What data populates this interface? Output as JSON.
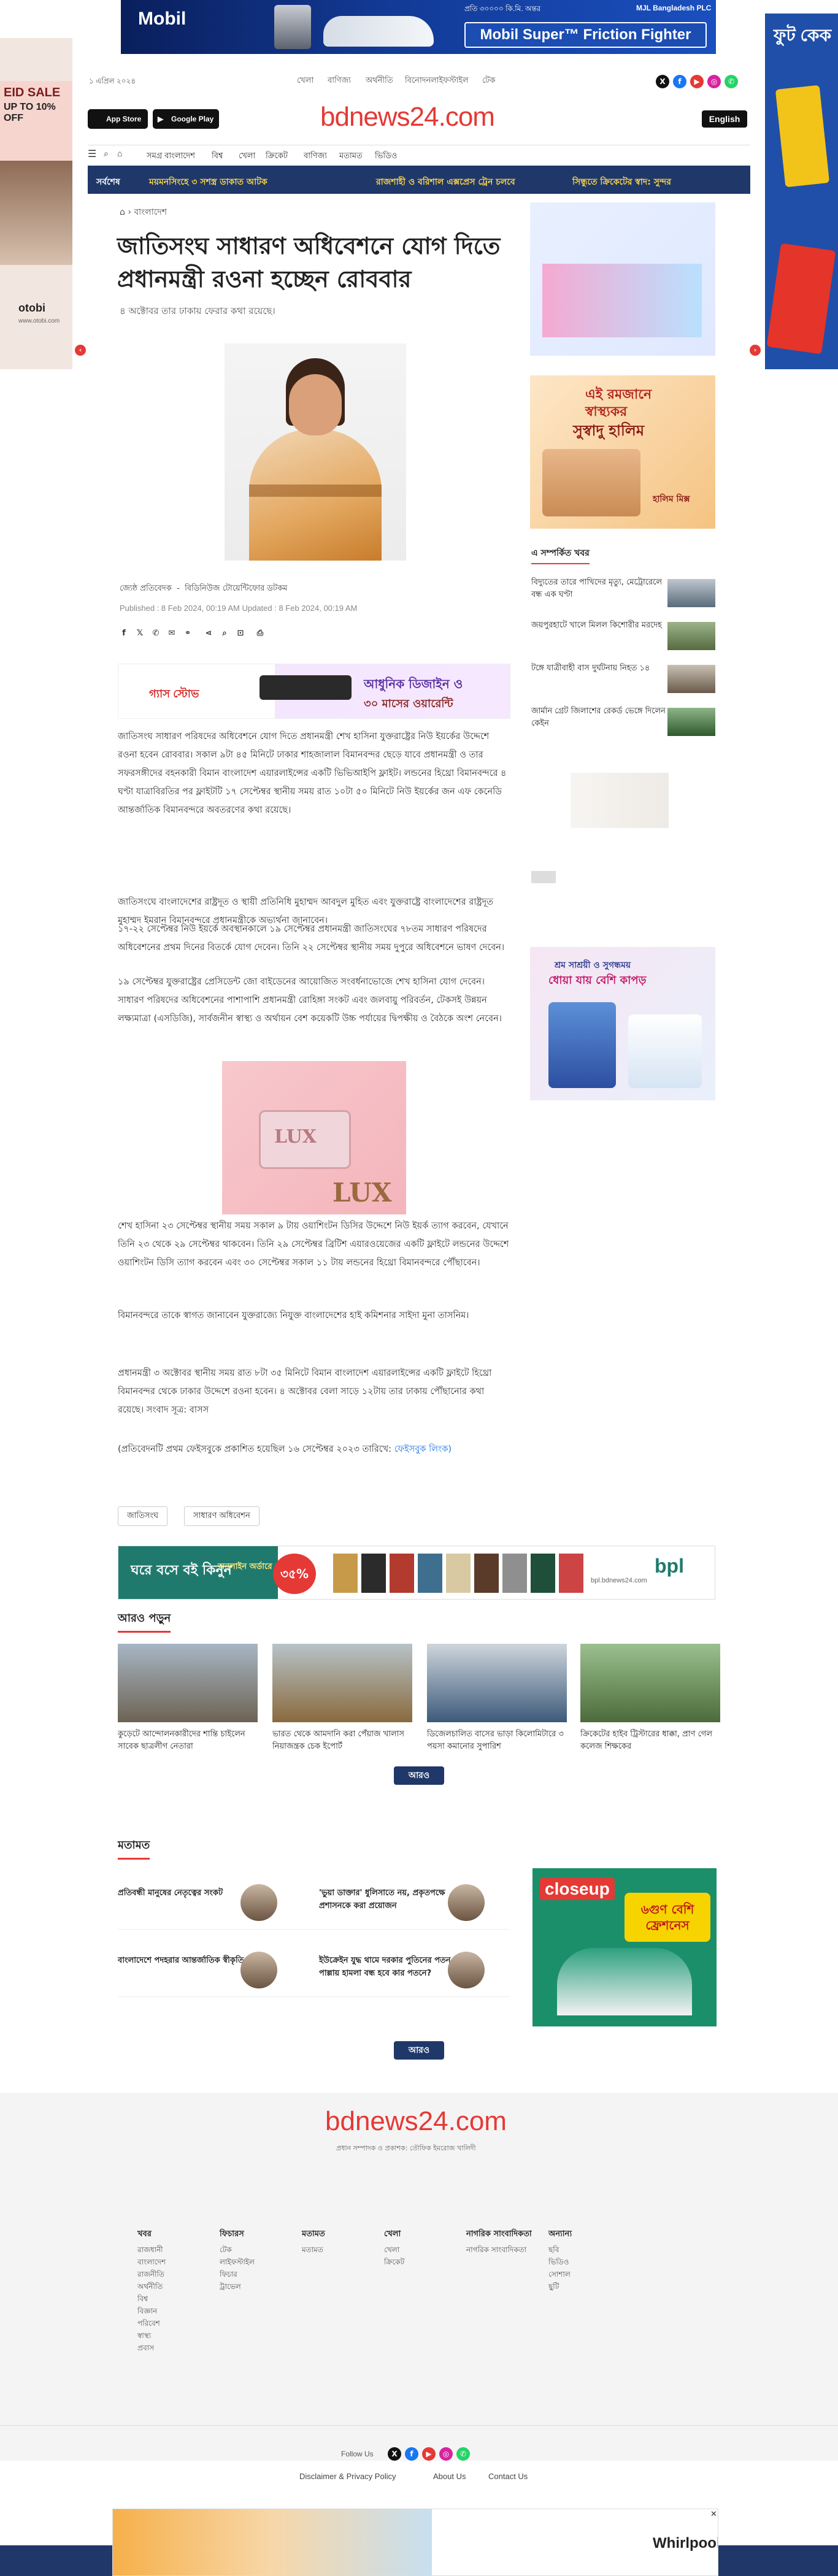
{
  "ads": {
    "top": {
      "brand": "Mobil",
      "product": "Mobil Super™ Friction Fighter",
      "note": "প্রতি ৩০০০০ কি.মি. অন্তর",
      "sponsor": "MJL Bangladesh PLC"
    },
    "left": {
      "line1": "EID SALE",
      "line2": "UP TO 10% OFF",
      "brand": "otobi",
      "url": "www.otobi.com"
    },
    "right": {
      "title": "ফুট কেক"
    },
    "ramadan": {
      "line1": "এই রমজানে",
      "line2": "স্বাস্থ্যকর",
      "line3": "সুস্বাদু হালিম",
      "brand": "হালিম মিক্স"
    },
    "mid": {
      "brand": "গ্যাস স্টোভ",
      "line1": "আধুনিক ডিজাইন ও",
      "line2": "৩০ মাসের ওয়ারেন্টি"
    },
    "lux": {
      "brand": "LUX"
    },
    "bpl": {
      "line1": "ঘরে বসে বই কিনুন",
      "line2": "অনলাইন অর্ডারে",
      "discount": "৩৫%",
      "brand": "bpl",
      "url": "bpl.bdnews24.com"
    },
    "closeup": {
      "brand": "closeup",
      "offer": "৬গুণ বেশি ফ্রেশনেস"
    },
    "soap": {
      "line1": "শ্রম সাশ্রয়ী ও সুগন্ধময়",
      "line2": "ধোয়া যায় বেশি কাপড়"
    },
    "bottom": {
      "brand": "Whirlpool"
    }
  },
  "header": {
    "date": "১ এপ্রিল ২০২৪",
    "nav_links": [
      "খেলা",
      "বাণিজ্য",
      "অর্থনীতি",
      "বিনোদন",
      "লাইফস্টাইল",
      "টেক"
    ],
    "app_store": "App Store",
    "google_play": "Google Play",
    "logo": "bdnews24.com",
    "english": "English",
    "menu": [
      "সমগ্র বাংলাদেশ",
      "বিশ্ব",
      "খেলা",
      "ক্রিকেট",
      "বাণিজ্য",
      "মতামত",
      "ভিডিও"
    ],
    "ticker_label": "সর্বশেষ",
    "ticker": [
      "ময়মনসিংহে ৩ সশস্ত্র ডাকাত আটক",
      "রাজশাহী ও বরিশাল এক্সপ্রেস ট্রেন চলবে",
      "সিন্ধুতে ক্রিকেটের স্বাদ: সুন্দর"
    ]
  },
  "article": {
    "breadcrumb": "বাংলাদেশ",
    "title": "জাতিসংঘ সাধারণ অধিবেশনে যোগ দিতে প্রধানমন্ত্রী রওনা হচ্ছেন রোববার",
    "subtitle": "৪ অক্টোবর তার ঢাকায় ফেরার কথা রয়েছে।",
    "reporter": "জ্যেষ্ঠ প্রতিবেদক",
    "reporter_office": "বিডিনিউজ টোয়েন্টিফোর ডটকম",
    "dates": "Published : 8 Feb 2024, 00:19 AM  Updated : 8 Feb 2024, 00:19 AM",
    "paragraphs": [
      "জাতিসংঘ সাধারণ পরিষদের অধিবেশনে যোগ দিতে প্রধানমন্ত্রী শেখ হাসিনা যুক্তরাষ্ট্রের নিউ ইয়র্কের উদ্দেশে রওনা হবেন রোববার। সকাল ৯টা ৪৫ মিনিটে ঢাকার শাহজালাল বিমানবন্দর ছেড়ে যাবে প্রধানমন্ত্রী ও তার সফরসঙ্গীদের বহনকারী বিমান বাংলাদেশ এয়ারলাইন্সের একটি ভিভিআইপি ফ্লাইট। লন্ডনের হিথ্রো বিমানবন্দরে ৪ ঘণ্টা যাত্রাবিরতির পর ফ্লাইটটি ১৭ সেপ্টেম্বর স্থানীয় সময় রাত ১০টা ৫০ মিনিটে নিউ ইয়র্কের জন এফ কেনেডি আন্তর্জাতিক বিমানবন্দরে অবতরণের কথা রয়েছে।",
      "জাতিসংঘে বাংলাদেশের রাষ্ট্রদূত ও স্থায়ী প্রতিনিধি মুহাম্মদ আবদুল মুহিত এবং যুক্তরাষ্ট্রে বাংলাদেশের রাষ্ট্রদূত মুহাম্মদ ইমরান বিমানবন্দরে প্রধানমন্ত্রীকে অভ্যর্থনা জানাবেন।",
      "১৭-২২ সেপ্টেম্বর নিউ ইয়র্কে অবস্থানকালে ১৯ সেপ্টেম্বর প্রধানমন্ত্রী জাতিসংঘের ৭৮তম সাধারণ পরিষদের অধিবেশনের প্রথম দিনের বিতর্কে যোগ দেবেন। তিনি ২২ সেপ্টেম্বর স্থানীয় সময় দুপুরে অধিবেশনে ভাষণ দেবেন।",
      "১৯ সেপ্টেম্বর যুক্তরাষ্ট্রের প্রেসিডেন্ট জো বাইডেনের আয়োজিত সংবর্ধনাভোজে শেখ হাসিনা যোগ দেবেন। সাধারণ পরিষদের অধিবেশনের পাশাপাশি প্রধানমন্ত্রী রোহিঙ্গা সংকট এবং জলবায়ু পরিবর্তন, টেকসই উন্নয়ন লক্ষ্যমাত্রা (এসডিজি), সার্বজনীন স্বাস্থ্য ও অর্থায়ন বেশ কয়েকটি উচ্চ পর্যায়ের দ্বিপক্ষীয় ও বৈঠকে অংশ নেবেন।",
      "শেখ হাসিনা ২৩ সেপ্টেম্বর স্থানীয় সময় সকাল ৯ টায় ওয়াশিংটন ডিসির উদ্দেশে নিউ ইয়র্ক ত্যাগ করবেন, যেখানে তিনি ২৩ থেকে ২৯ সেপ্টেম্বর থাকবেন। তিনি ২৯ সেপ্টেম্বর ব্রিটিশ এয়ারওয়েজের একটি ফ্লাইটে লন্ডনের উদ্দেশে ওয়াশিংটন ডিসি ত্যাগ করবেন এবং ৩০ সেপ্টেম্বর সকাল ১১ টায় লন্ডনের হিথ্রো বিমানবন্দরে পৌঁছাবেন।",
      "বিমানবন্দরে তাকে স্বাগত জানাবেন যুক্তরাজ্যে নিযুক্ত বাংলাদেশের হাই কমিশনার সাইদা মুনা তাসনিম।",
      "প্রধানমন্ত্রী ৩ অক্টোবর স্থানীয় সময় রাত ৮টা ৩৫ মিনিটে বিমান বাংলাদেশ এয়ারলাইন্সের একটি ফ্লাইটে হিথ্রো বিমানবন্দর থেকে ঢাকার উদ্দেশে রওনা হবেন। ৪ অক্টোবর বেলা সাড়ে ১২টায় তার ঢাকায় পৌঁছানোর কথা রয়েছে। সংবাদ সূত্র: বাসস"
    ],
    "footnote": "(প্রতিবেদনটি প্রথম ফেইসবুকে প্রকাশিত হয়েছিল ১৬ সেপ্টেম্বর ২০২৩ তারিখে: ",
    "footnote_link": "ফেইসবুক লিংক)",
    "tags": [
      "জাতিসংঘ",
      "সাধারণ অধিবেশন"
    ]
  },
  "related": {
    "heading": "এ সম্পর্কিত খবর",
    "items": [
      "বিদ্যুতের তারে পাখিদের মৃত্যু, মেট্রোরেলে বন্ধ এক ঘণ্টা",
      "জয়পুরহাটে খালে মিলল কিশোরীর মরদেহ",
      "টঙ্গে যাত্রীবাহী বাস দুর্ঘটনায় নিহত ১৪",
      "জার্মান গ্রেট জিলাশের রেকর্ড ভেঙ্গে দিলেন কেইন"
    ]
  },
  "read_more": {
    "heading": "আরও পড়ুন",
    "items": [
      "কুড়েটে আন্দোলনকারীদের শান্তি চাইলেন সাবেক ছাত্রলীগ নেতারা",
      "ভারত থেকে আমদানি করা পেঁয়াজ খালাস নিয়াজন্ত্রক চেক ইপোর্ট",
      "ডিজেলচালিত বাসের ভাড়া কিলোমিটারে ৩ পয়সা কমানোর সুপারিশ",
      "ক্রিকেটের হাইব ট্রিস্টারের ধাক্কা, প্রাণ গেল কলেজ শিক্ষকের"
    ],
    "more": "আরও"
  },
  "opinion": {
    "heading": "মতামত",
    "items": [
      "প্রতিবন্ধী মানুষের নেতৃত্বের সংকট",
      "'ভুয়া ডাক্তার' ধুলিসাতে নয়, প্রকৃতপক্ষে প্রশাসনকে করা প্রয়োজন",
      "বাংলাদেশে পদহরার আন্তর্জাতিক স্বীকৃতি",
      "ইউক্রেইন যুদ্ধ থামে দরকার পুতিনের পতন, পাল্লায় হামলা বন্ধ হবে কার পতনে?"
    ],
    "more": "আরও"
  },
  "footer": {
    "logo": "bdnews24.com",
    "sub": "প্রধান সম্পাদক ও প্রকাশক: তৌফিক ইমরোজ খালিদী",
    "columns": [
      {
        "head": "খবর",
        "links": [
          "রাজধানী",
          "বাংলাদেশ",
          "রাজনীতি",
          "অর্থনীতি",
          "বিশ্ব",
          "বিজ্ঞান",
          "পরিবেশ",
          "স্বাস্থ্য",
          "প্রবাস"
        ]
      },
      {
        "head": "ফিচারস",
        "links": [
          "টেক",
          "লাইফস্টাইল",
          "ফিচার",
          "ট্রাভেল"
        ]
      },
      {
        "head": "মতামত",
        "links": [
          "মতামত"
        ]
      },
      {
        "head": "খেলা",
        "links": [
          "খেলা",
          "ক্রিকেট"
        ]
      },
      {
        "head": "নাগরিক সাংবাদিকতা",
        "links": [
          "নাগরিক সাংবাদিকতা"
        ]
      },
      {
        "head": "অন্যান্য",
        "links": [
          "ছবি",
          "ভিডিও",
          "সোশাল",
          "ছুটি"
        ]
      }
    ],
    "follow": "Follow Us",
    "links": [
      "Disclaimer & Privacy Policy",
      "About Us",
      "Contact Us"
    ]
  }
}
